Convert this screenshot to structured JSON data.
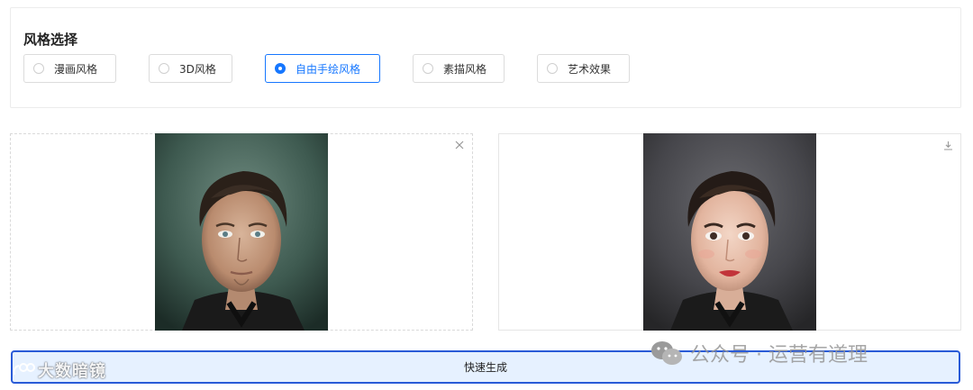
{
  "style_panel": {
    "title": "风格选择",
    "options": [
      {
        "label": "漫画风格",
        "selected": false
      },
      {
        "label": "3D风格",
        "selected": false
      },
      {
        "label": "自由手绘风格",
        "selected": true
      },
      {
        "label": "素描风格",
        "selected": false
      },
      {
        "label": "艺术效果",
        "selected": false
      }
    ]
  },
  "source_image": {
    "close_icon": "close-icon"
  },
  "result_image": {
    "download_icon": "download-icon"
  },
  "generate_button": {
    "label": "快速生成"
  },
  "watermarks": {
    "left": "大数暗镜",
    "right": "公众号 · 运营有道理"
  },
  "colors": {
    "accent": "#1677ff",
    "button_border": "#2a5bd7",
    "button_bg": "#e6f1ff"
  }
}
